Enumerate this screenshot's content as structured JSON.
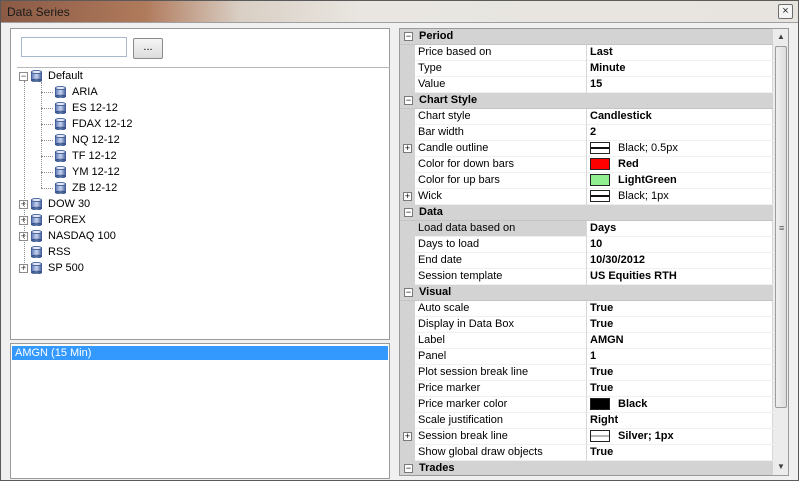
{
  "window": {
    "title": "Data Series",
    "close_glyph": "×"
  },
  "search": {
    "value": "",
    "placeholder": "",
    "browse_label": "..."
  },
  "tree": [
    {
      "label": "Default",
      "level": 0,
      "expander": "−",
      "children": [
        {
          "label": "ARIA"
        },
        {
          "label": "ES 12-12"
        },
        {
          "label": "FDAX 12-12"
        },
        {
          "label": "NQ 12-12"
        },
        {
          "label": "TF 12-12"
        },
        {
          "label": "YM 12-12"
        },
        {
          "label": "ZB 12-12"
        }
      ]
    },
    {
      "label": "DOW 30",
      "expander": "+"
    },
    {
      "label": "FOREX",
      "expander": "+"
    },
    {
      "label": "NASDAQ 100",
      "expander": "+"
    },
    {
      "label": "RSS",
      "expander": ""
    },
    {
      "label": "SP 500",
      "expander": "+"
    }
  ],
  "series_list": [
    {
      "label": "AMGN (15 Min)",
      "selected": true
    }
  ],
  "property_grid": [
    {
      "category": "Period",
      "expanded": true,
      "rows": [
        {
          "name": "Price based on",
          "value": "Last"
        },
        {
          "name": "Type",
          "value": "Minute"
        },
        {
          "name": "Value",
          "value": "15"
        }
      ]
    },
    {
      "category": "Chart Style",
      "expanded": true,
      "rows": [
        {
          "name": "Chart style",
          "value": "Candlestick"
        },
        {
          "name": "Bar width",
          "value": "2"
        },
        {
          "name": "Candle outline",
          "value": "Black; 0.5px",
          "swatch": "line-black",
          "expandable": true,
          "bold": false
        },
        {
          "name": "Color for down bars",
          "value": "Red",
          "swatch": "#ff0000"
        },
        {
          "name": "Color for up bars",
          "value": "LightGreen",
          "swatch": "#90ee90"
        },
        {
          "name": "Wick",
          "value": "Black; 1px",
          "swatch": "line-black",
          "expandable": true,
          "bold": false
        }
      ]
    },
    {
      "category": "Data",
      "expanded": true,
      "rows": [
        {
          "name": "Load data based on",
          "value": "Days",
          "highlight": true
        },
        {
          "name": "Days to load",
          "value": "10"
        },
        {
          "name": "End date",
          "value": "10/30/2012"
        },
        {
          "name": "Session template",
          "value": "US Equities RTH"
        }
      ]
    },
    {
      "category": "Visual",
      "expanded": true,
      "rows": [
        {
          "name": "Auto scale",
          "value": "True"
        },
        {
          "name": "Display in Data Box",
          "value": "True"
        },
        {
          "name": "Label",
          "value": "AMGN"
        },
        {
          "name": "Panel",
          "value": "1"
        },
        {
          "name": "Plot session break line",
          "value": "True"
        },
        {
          "name": "Price marker",
          "value": "True"
        },
        {
          "name": "Price marker color",
          "value": "Black",
          "swatch": "#000000"
        },
        {
          "name": "Scale justification",
          "value": "Right"
        },
        {
          "name": "Session break line",
          "value": "Silver; 1px",
          "swatch": "line-silver",
          "expandable": true
        },
        {
          "name": "Show global draw objects",
          "value": "True"
        }
      ]
    },
    {
      "category": "Trades",
      "expanded": true,
      "rows": []
    }
  ],
  "expand_glyphs": {
    "collapse": "−",
    "expand": "+"
  },
  "scrollbar": {
    "up": "▲",
    "down": "▼",
    "grip": "≡"
  },
  "colors": {
    "selection": "#3399ff",
    "category_bg": "#d3d3d3"
  }
}
